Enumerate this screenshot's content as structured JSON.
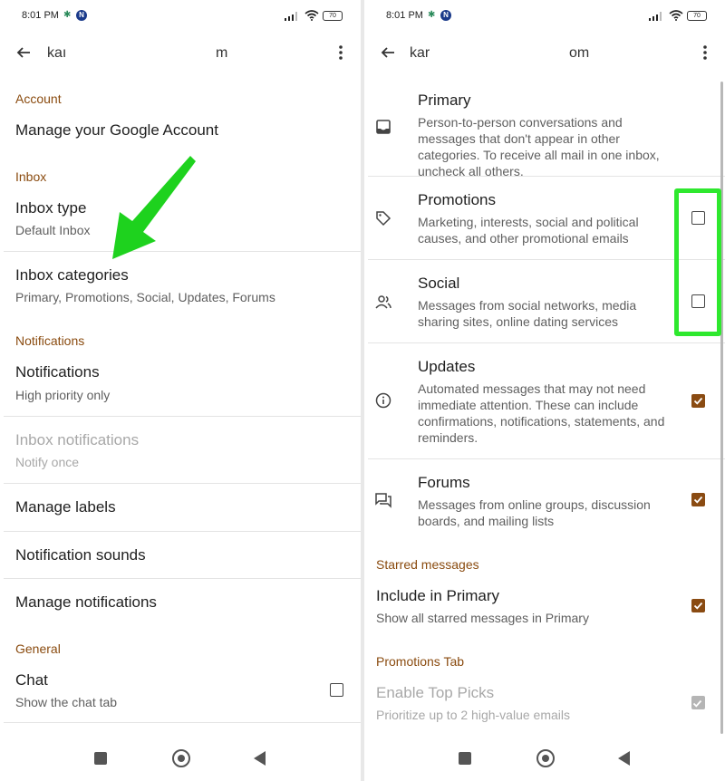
{
  "status": {
    "time": "8:01 PM",
    "battery": "70"
  },
  "left": {
    "account_label_a": "kaı",
    "account_label_b": "m",
    "sections": {
      "account": "Account",
      "inbox": "Inbox",
      "notifications": "Notifications",
      "general": "General"
    },
    "items": {
      "manage_account": "Manage your Google Account",
      "inbox_type_title": "Inbox type",
      "inbox_type_sub": "Default Inbox",
      "inbox_categories_title": "Inbox categories",
      "inbox_categories_sub": "Primary, Promotions, Social, Updates, Forums",
      "notifications_title": "Notifications",
      "notifications_sub": "High priority only",
      "inbox_notifications_title": "Inbox notifications",
      "inbox_notifications_sub": "Notify once",
      "manage_labels": "Manage labels",
      "notification_sounds": "Notification sounds",
      "manage_notifications": "Manage notifications",
      "chat_title": "Chat",
      "chat_sub": "Show the chat tab"
    },
    "chat_checked": false
  },
  "right": {
    "account_label_a": "kar",
    "account_label_b": "om",
    "categories": [
      {
        "title": "Primary",
        "desc": "Person-to-person conversations and messages that don't appear in other categories. To receive all mail in one inbox, uncheck all others.",
        "icon": "inbox-icon",
        "checked": null
      },
      {
        "title": "Promotions",
        "desc": "Marketing, interests, social and political causes, and other promotional emails",
        "icon": "tag-icon",
        "checked": false
      },
      {
        "title": "Social",
        "desc": "Messages from social networks, media sharing sites, online dating services",
        "icon": "people-icon",
        "checked": false
      },
      {
        "title": "Updates",
        "desc": "Automated messages that may not need immediate attention. These can include confirmations, notifications, statements, and reminders.",
        "icon": "info-icon",
        "checked": true
      },
      {
        "title": "Forums",
        "desc": "Messages from online groups, discussion boards, and mailing lists",
        "icon": "forum-icon",
        "checked": true
      }
    ],
    "starred_section": "Starred messages",
    "include_primary_title": "Include in Primary",
    "include_primary_sub": "Show all starred messages in Primary",
    "promotions_tab_section": "Promotions Tab",
    "top_picks_title": "Enable Top Picks",
    "top_picks_sub": "Prioritize up to 2 high-value emails"
  },
  "colors": {
    "accent": "#8a4b12",
    "highlight": "#2ee82e",
    "arrow": "#1ed21e"
  }
}
